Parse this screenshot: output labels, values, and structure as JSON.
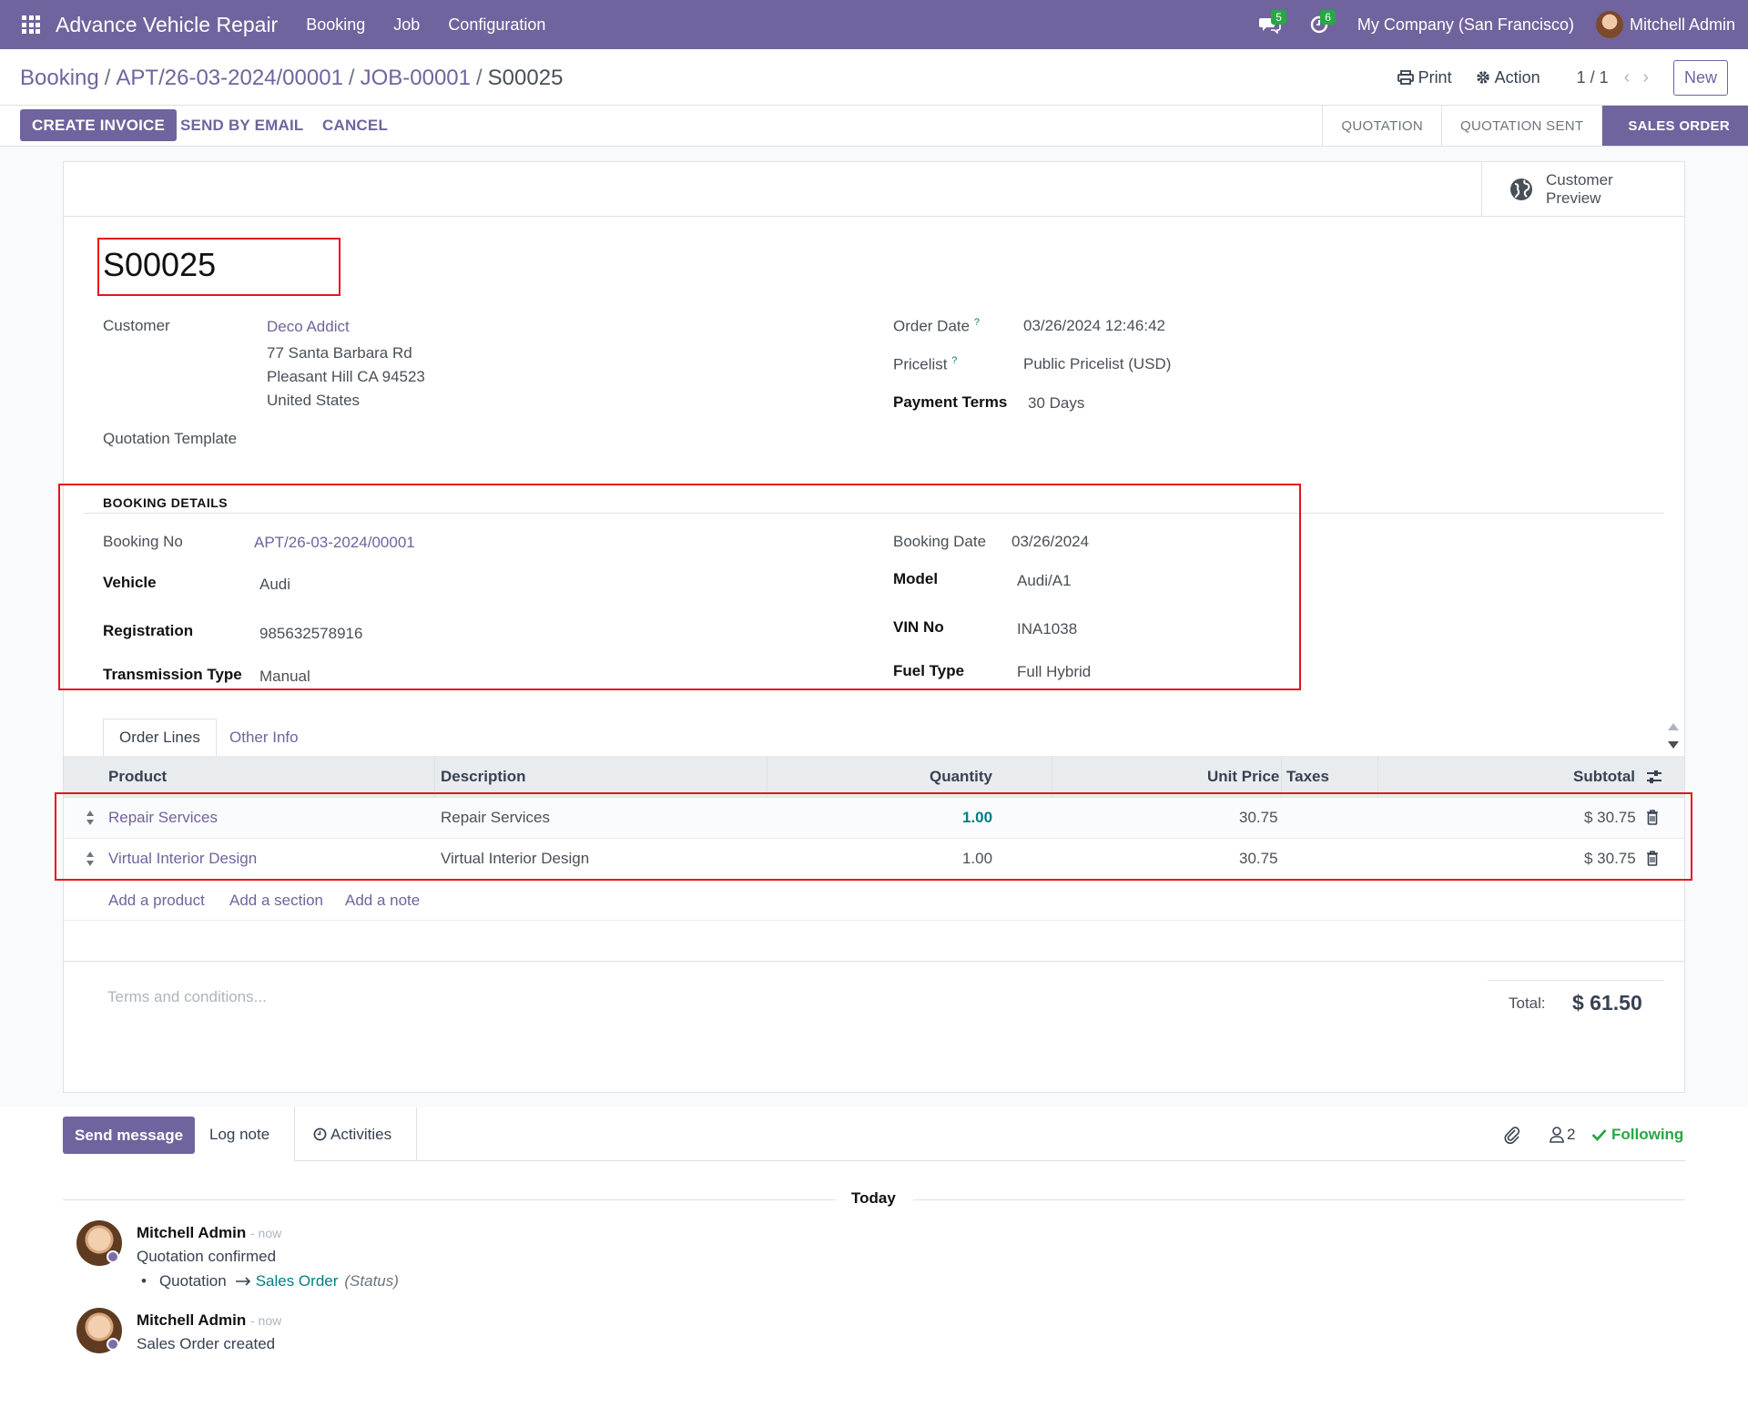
{
  "navbar": {
    "app_name": "Advance Vehicle Repair",
    "menu": [
      "Booking",
      "Job",
      "Configuration"
    ],
    "messages_count": "5",
    "activities_count": "6",
    "company": "My Company (San Francisco)",
    "user": "Mitchell Admin"
  },
  "breadcrumb": [
    "Booking",
    "APT/26-03-2024/00001",
    "JOB-00001",
    "S00025"
  ],
  "control": {
    "print": "Print",
    "action": "Action",
    "pager": "1 / 1",
    "new": "New"
  },
  "statusbar": {
    "buttons": [
      "CREATE INVOICE",
      "SEND BY EMAIL",
      "CANCEL"
    ],
    "stages": [
      "QUOTATION",
      "QUOTATION SENT",
      "SALES ORDER"
    ],
    "active_stage": "SALES ORDER"
  },
  "button_box": {
    "customer_preview": [
      "Customer",
      "Preview"
    ]
  },
  "order": {
    "name": "S00025",
    "customer_label": "Customer",
    "customer_name": "Deco Addict",
    "customer_address": [
      "77 Santa Barbara Rd",
      "Pleasant Hill CA 94523",
      "United States"
    ],
    "quotation_template_label": "Quotation Template",
    "order_date_label": "Order Date",
    "order_date": "03/26/2024 12:46:42",
    "pricelist_label": "Pricelist",
    "pricelist": "Public Pricelist (USD)",
    "payment_terms_label": "Payment Terms",
    "payment_terms": "30 Days",
    "help_mark": "?"
  },
  "booking": {
    "title": "BOOKING DETAILS",
    "booking_no_label": "Booking No",
    "booking_no": "APT/26-03-2024/00001",
    "vehicle_label": "Vehicle",
    "vehicle": "Audi",
    "registration_label": "Registration",
    "registration": "985632578916",
    "transmission_label": "Transmission Type",
    "transmission": "Manual",
    "booking_date_label": "Booking Date",
    "booking_date": "03/26/2024",
    "model_label": "Model",
    "model": "Audi/A1",
    "vin_label": "VIN No",
    "vin": "INA1038",
    "fuel_label": "Fuel Type",
    "fuel": "Full Hybrid"
  },
  "tabs": [
    "Order Lines",
    "Other Info"
  ],
  "table": {
    "columns": [
      "Product",
      "Description",
      "Quantity",
      "Unit Price",
      "Taxes",
      "Subtotal"
    ],
    "rows": [
      {
        "product": "Repair Services",
        "description": "Repair Services",
        "quantity": "1.00",
        "unit_price": "30.75",
        "taxes": "",
        "subtotal": "$ 30.75"
      },
      {
        "product": "Virtual Interior Design",
        "description": "Virtual Interior Design",
        "quantity": "1.00",
        "unit_price": "30.75",
        "taxes": "",
        "subtotal": "$ 30.75"
      }
    ],
    "add_links": [
      "Add a product",
      "Add a section",
      "Add a note"
    ]
  },
  "footer": {
    "terms_placeholder": "Terms and conditions...",
    "total_label": "Total:",
    "total_value": "$ 61.50"
  },
  "chatter": {
    "send_message": "Send message",
    "log_note": "Log note",
    "activities": "Activities",
    "followers_count": "2",
    "following": "Following",
    "date_separator": "Today",
    "messages": [
      {
        "author": "Mitchell Admin",
        "time": "- now",
        "body": "Quotation confirmed",
        "track_from": "Quotation",
        "track_to": "Sales Order",
        "track_field": "(Status)"
      },
      {
        "author": "Mitchell Admin",
        "time": "- now",
        "body": "Sales Order created"
      }
    ]
  },
  "colors": {
    "brand": "#71639e",
    "accent": "#017e84",
    "success": "#28a745",
    "annotation": "#e5141e"
  }
}
